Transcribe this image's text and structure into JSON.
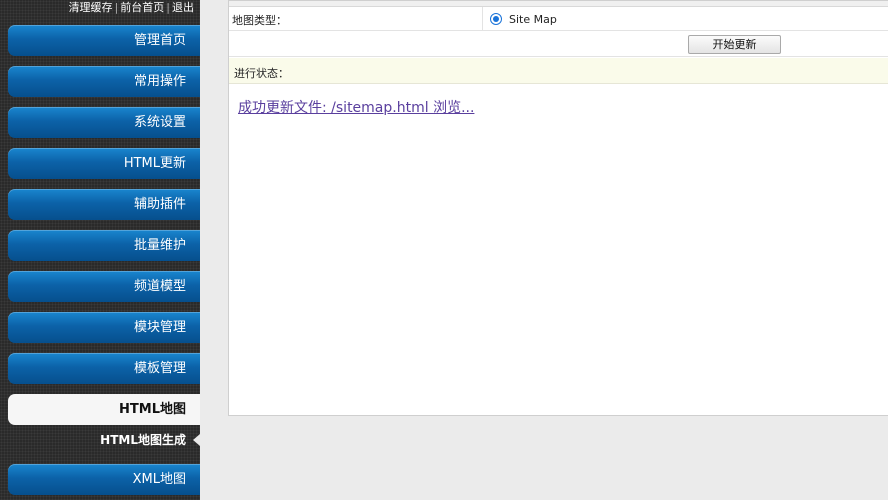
{
  "top_links": [
    "清理缓存",
    "前台首页",
    "退出"
  ],
  "top_links_separator": "|",
  "sidebar": {
    "items": [
      {
        "label": "管理首页"
      },
      {
        "label": "常用操作"
      },
      {
        "label": "系统设置"
      },
      {
        "label": "HTML更新"
      },
      {
        "label": "辅助插件"
      },
      {
        "label": "批量维护"
      },
      {
        "label": "频道模型"
      },
      {
        "label": "模块管理"
      },
      {
        "label": "模板管理"
      },
      {
        "label": "HTML地图"
      },
      {
        "label": "XML地图"
      }
    ],
    "active_item": "HTML地图",
    "submenu": {
      "label": "HTML地图生成"
    }
  },
  "form": {
    "map_type_label": "地图类型：",
    "map_type_option": "Site Map",
    "map_type_selected": true,
    "start_button": "开始更新",
    "status_label": "进行状态："
  },
  "status": {
    "result_link": "成功更新文件: /sitemap.html 浏览..."
  },
  "colors": {
    "menu_blue": "#0c62a8",
    "sidebar_bg": "#2a2a2a",
    "status_bg": "#fafbea",
    "link_color": "#5a3f9e",
    "radio_blue": "#1a73d9"
  }
}
